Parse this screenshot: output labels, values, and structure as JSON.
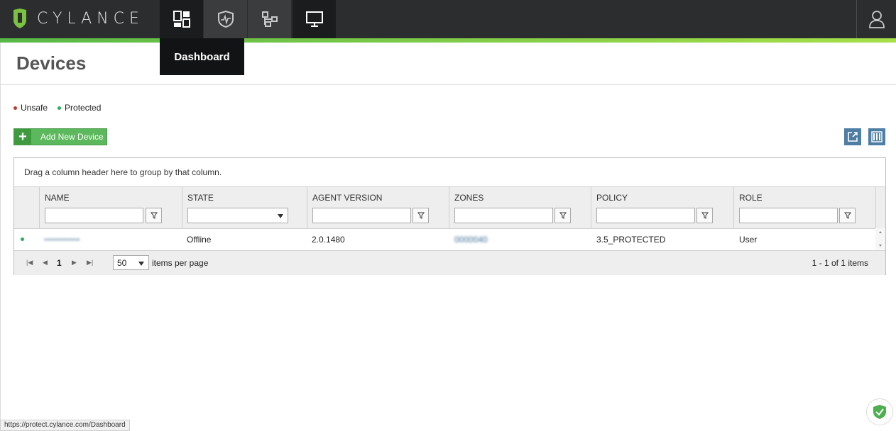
{
  "app": {
    "brand": "CYLANCE"
  },
  "nav": {
    "tabs": [
      {
        "name": "dashboard",
        "icon": "dashboard-icon"
      },
      {
        "name": "protection",
        "icon": "shield-icon"
      },
      {
        "name": "zones",
        "icon": "network-icon"
      },
      {
        "name": "devices",
        "icon": "monitor-icon"
      }
    ],
    "tooltip": "Dashboard",
    "user_icon": "user-icon"
  },
  "page": {
    "title": "Devices"
  },
  "legend": [
    {
      "label": "Unsafe",
      "color": "#c0392b"
    },
    {
      "label": "Protected",
      "color": "#27ae60"
    }
  ],
  "toolbar": {
    "add_label": "Add New Device",
    "export_icon": "export-icon",
    "columns_icon": "columns-icon"
  },
  "grid": {
    "group_hint": "Drag a column header here to group by that column.",
    "columns": [
      "NAME",
      "STATE",
      "AGENT VERSION",
      "ZONES",
      "POLICY",
      "ROLE"
    ],
    "rows": [
      {
        "status_color": "#27ae60",
        "name": "••••••••••••",
        "state": "Offline",
        "agent_version": "2.0.1480",
        "zones": "0000040",
        "policy": "3.5_PROTECTED",
        "role": "User"
      }
    ]
  },
  "pager": {
    "current_page": "1",
    "page_size": "50",
    "items_per_page_label": "items per page",
    "summary": "1 - 1 of 1 items"
  },
  "statusbar": {
    "url": "https://protect.cylance.com/Dashboard"
  }
}
